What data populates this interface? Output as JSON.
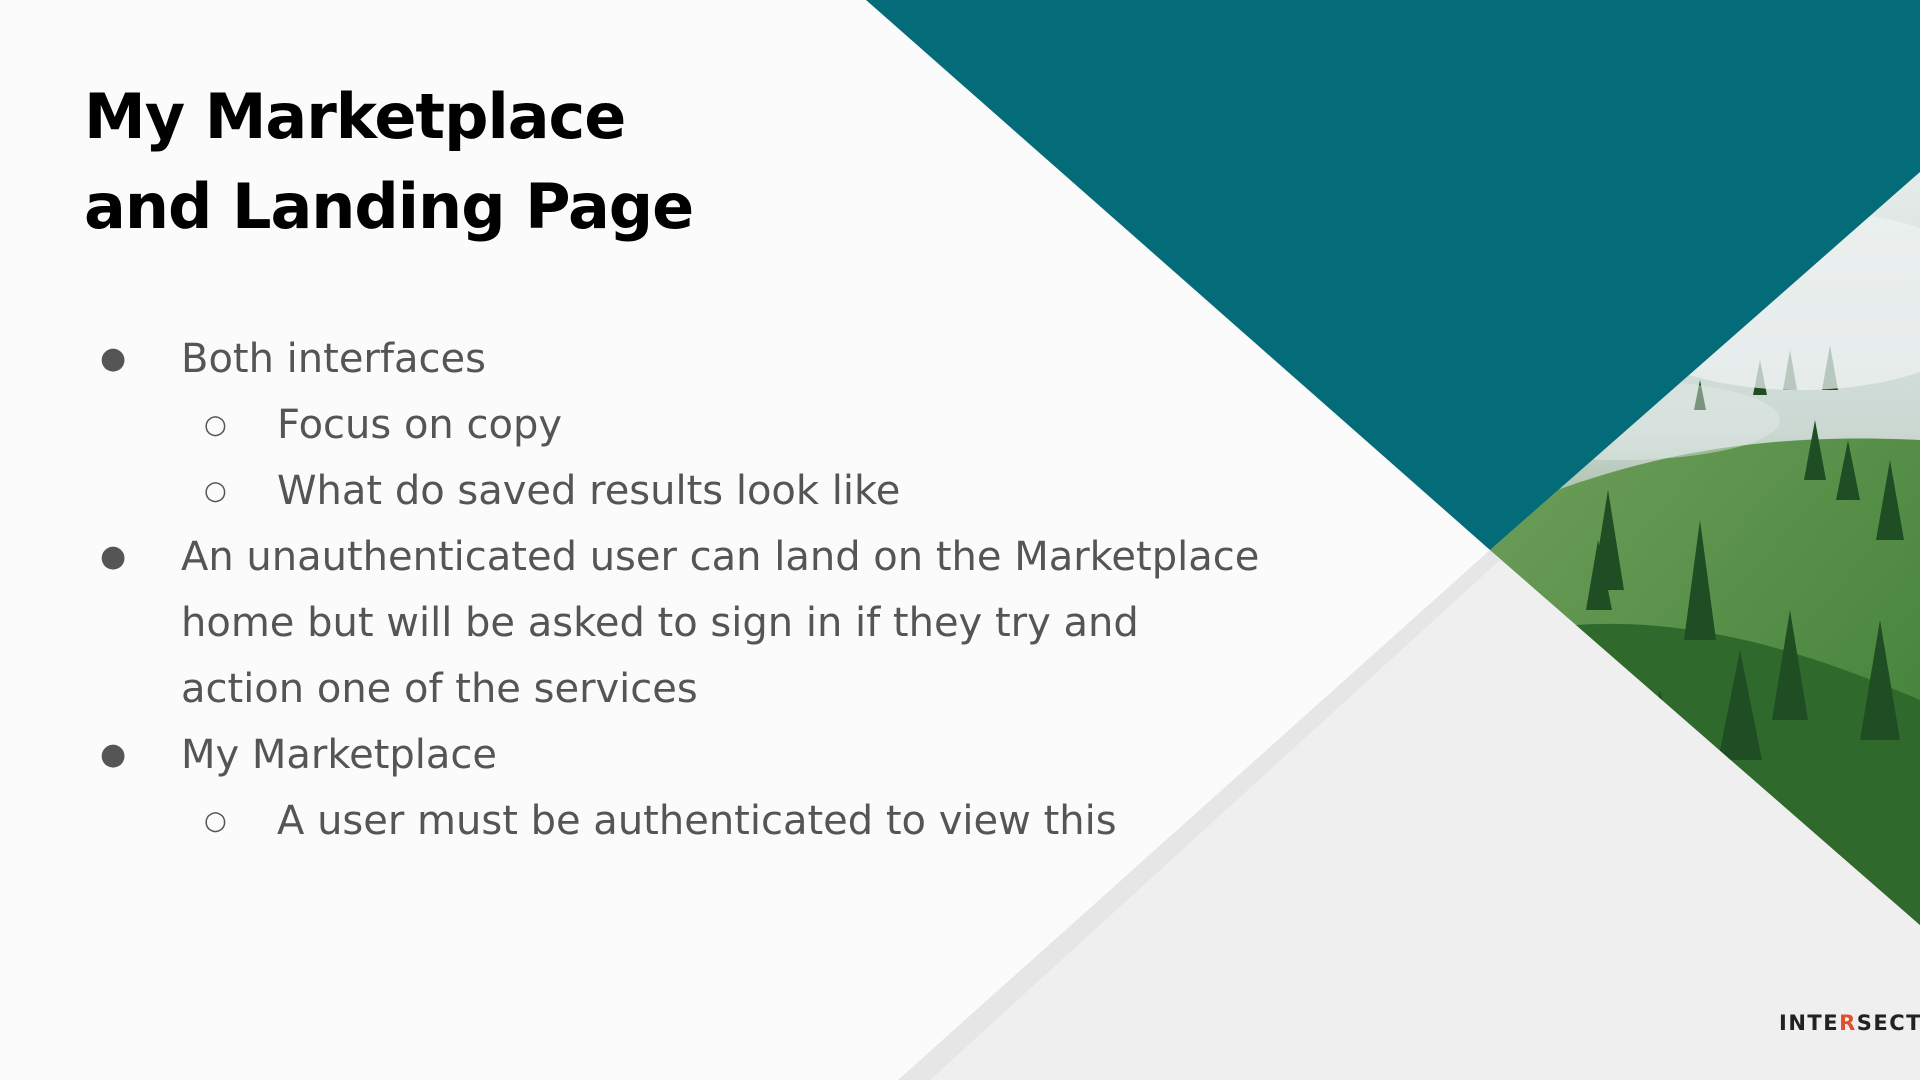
{
  "slide": {
    "title_lines": [
      "My Marketplace",
      "and Landing Page"
    ],
    "bullets": [
      {
        "level": 1,
        "marker": "●",
        "text": "Both interfaces"
      },
      {
        "level": 2,
        "marker": "○",
        "text": "Focus on copy"
      },
      {
        "level": 2,
        "marker": "○",
        "text": "What do saved results look like"
      },
      {
        "level": 1,
        "marker": "●",
        "text": "An unauthenticated user can land on the Marketplace home but will be asked to sign in if they try and action one of the services"
      },
      {
        "level": 1,
        "marker": "●",
        "text": "My Marketplace"
      },
      {
        "level": 2,
        "marker": "○",
        "text": "A user must be authenticated to view this"
      }
    ]
  },
  "brand": {
    "prefix": "INTE",
    "accent": "R",
    "suffix": "SECT"
  },
  "colors": {
    "teal": "#046c78",
    "accent_orange": "#e0502c",
    "bullet_text": "#555555",
    "title_text": "#000000"
  }
}
